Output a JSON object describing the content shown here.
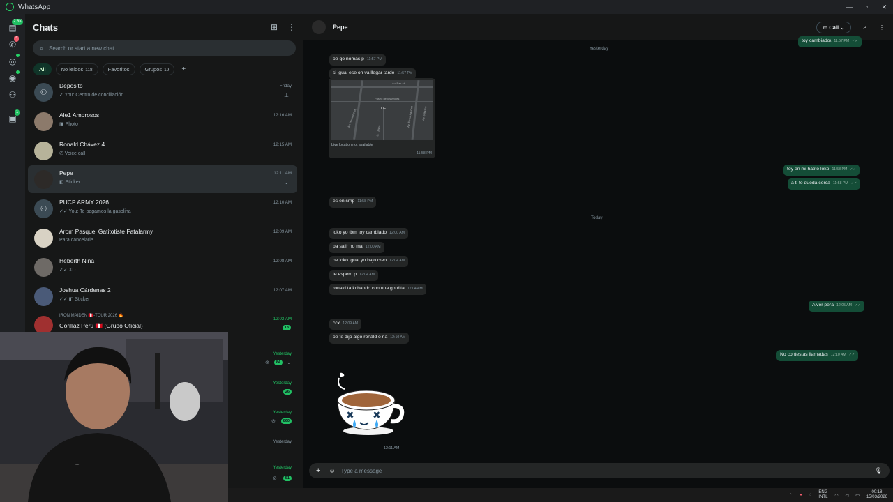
{
  "window": {
    "title": "WhatsApp"
  },
  "rail": {
    "chats_badge": "2.8K",
    "calls_badge": "4",
    "communities_badge": "1"
  },
  "chatlist": {
    "title": "Chats",
    "search_placeholder": "Search or start a new chat",
    "filters": [
      {
        "label": "All",
        "count": ""
      },
      {
        "label": "No leídos",
        "count": "118"
      },
      {
        "label": "Favoritos",
        "count": ""
      },
      {
        "label": "Grupos",
        "count": "19"
      }
    ],
    "chats": [
      {
        "name": "Deposito",
        "preview": "✓ You: Centro de conciliación",
        "time": "Friday",
        "group": true,
        "pinned": true
      },
      {
        "name": "Ale1 Amorosos",
        "preview": "▣ Photo",
        "time": "12:16 AM"
      },
      {
        "name": "Ronald Chávez 4",
        "preview": "✆ Voice call",
        "time": "12:15 AM"
      },
      {
        "name": "Pepe",
        "preview": "◧ Sticker",
        "time": "12:11 AM",
        "selected": true
      },
      {
        "name": "PUCP ARMY 2026",
        "preview": "✓✓ You: Te pagamos la gasolina",
        "time": "12:10 AM",
        "group": true
      },
      {
        "name": "Arom Pasquel Gatitotiste Fatalarmy",
        "preview": "Para cancelarle",
        "time": "12:09 AM"
      },
      {
        "name": "Heberth  Nina",
        "preview": "✓✓ XD",
        "time": "12:08 AM"
      },
      {
        "name": "Joshua Cárdenas 2",
        "preview": "✓✓ ◧ Sticker",
        "time": "12:07 AM"
      },
      {
        "name": "Gorillaz Perú 🇵🇪 (Grupo Oficial)",
        "top": "IRON MAIDEN 🇵🇪-TOUR 2026 🔥",
        "time": "12:02 AM",
        "unread": "13",
        "green": true
      }
    ],
    "below_cam": [
      {
        "time": "Yesterday",
        "unread": "84"
      },
      {
        "time": "Yesterday",
        "unread": "26"
      },
      {
        "time": "Yesterday",
        "unread": "860"
      },
      {
        "time": "Yesterday",
        "unread": ""
      },
      {
        "time": "Yesterday",
        "unread": "51"
      }
    ]
  },
  "conversation": {
    "contact": "Pepe",
    "call_label": "Call",
    "composer_placeholder": "Type a message",
    "messages": [
      {
        "dir": "out",
        "text": "toy cambiado\\",
        "time": "11:57 PM"
      },
      {
        "dir": "date",
        "text": "Yesterday"
      },
      {
        "dir": "in",
        "text": "oe go nomas p",
        "time": "11:57 PM"
      },
      {
        "dir": "in",
        "text": "si igual ese on va llegar tarde",
        "time": "11:57 PM"
      },
      {
        "dir": "out",
        "text": "toy en mi hatito loko",
        "time": "11:58 PM"
      },
      {
        "dir": "out",
        "text": "a ti te queda cerca",
        "time": "11:58 PM"
      },
      {
        "dir": "in",
        "text": "es en smp",
        "time": "11:58 PM"
      },
      {
        "dir": "date",
        "text": "Today"
      },
      {
        "dir": "in",
        "text": "loko yo tbm toy cambiado",
        "time": "12:00 AM"
      },
      {
        "dir": "in",
        "text": "pa salir no ma",
        "time": "12:00 AM"
      },
      {
        "dir": "in",
        "text": "oe loko igual yo bajo creo",
        "time": "12:04 AM"
      },
      {
        "dir": "in",
        "text": "te espero p",
        "time": "12:04 AM"
      },
      {
        "dir": "in",
        "text": "ronald ta kchando con una gordita",
        "time": "12:04 AM"
      },
      {
        "dir": "out",
        "text": "A ver pera",
        "time": "12:05 AM"
      },
      {
        "dir": "in",
        "text": "ccx",
        "time": "12:09 AM"
      },
      {
        "dir": "in",
        "text": "oe te dijo algo ronald o na",
        "time": "12:10 AM"
      },
      {
        "dir": "out",
        "text": "No contestas llamadas",
        "time": "12:10 AM"
      }
    ],
    "location": {
      "caption": "Live location not available",
      "time": "11:58 PM",
      "map_labels": [
        "Av. Pas Ab",
        "Paseo de los Andes",
        "OE",
        "Av. Huaraganes",
        "Jr. Ulises",
        "Av. Elvira Faucett",
        "Av. Velasco"
      ]
    },
    "sticker_time": "12:11 AM"
  },
  "taskbar": {
    "lang_top": "ENG",
    "lang_bottom": "INTL",
    "time": "00:18",
    "date": "15/03/2026"
  }
}
